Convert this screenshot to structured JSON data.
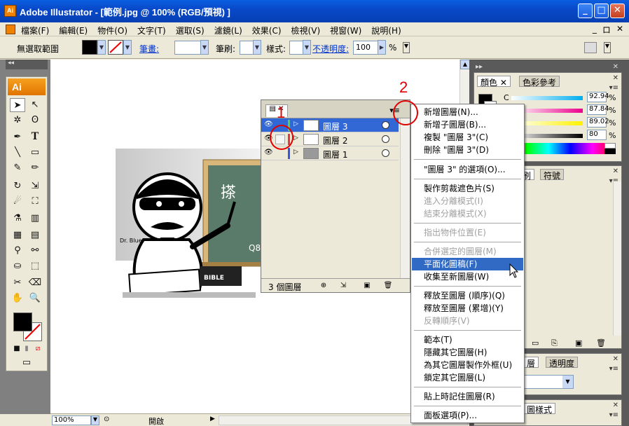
{
  "window": {
    "title": "Adobe Illustrator - [範例.jpg @ 100% (RGB/預視) ]",
    "app_icon": "Ai",
    "minimize": "_",
    "maximize": "□",
    "close": "✕"
  },
  "menubar": {
    "items": [
      "檔案(F)",
      "編輯(E)",
      "物件(O)",
      "文字(T)",
      "選取(S)",
      "濾鏡(L)",
      "效果(C)",
      "檢視(V)",
      "視窗(W)",
      "說明(H)"
    ],
    "mdi": [
      "_",
      "ロ",
      "✕"
    ]
  },
  "controlbar": {
    "selection_label": "無選取範圍",
    "stroke_label": "筆畫:",
    "brush_label": "筆刷:",
    "style_label": "樣式:",
    "opacity_label": "不透明度:",
    "opacity_value": "100",
    "opacity_unit": "%"
  },
  "toolbox": {
    "ai_label": "Ai",
    "strip_label": "◂◂"
  },
  "statusbar": {
    "zoom": "100%",
    "status": "開啟"
  },
  "color_panel": {
    "tabs": [
      "顏色",
      "色彩參考"
    ],
    "channels": [
      {
        "label": "C",
        "value": "92.94",
        "unit": "%",
        "color": "#00aeef"
      },
      {
        "label": "M",
        "value": "87.84",
        "unit": "%",
        "color": "#ec008c"
      },
      {
        "label": "Y",
        "value": "89.02",
        "unit": "%",
        "color": "#fff200"
      },
      {
        "label": "K",
        "value": "80",
        "unit": "%",
        "color": "#000000"
      }
    ]
  },
  "brushes_panel": {
    "tabs": [
      "刷",
      "符號"
    ]
  },
  "transparency_panel": {
    "tabs": [
      "層",
      "透明度"
    ]
  },
  "graphic_styles_panel": {
    "tabs": [
      "圖樣式"
    ]
  },
  "layers_panel": {
    "rows": [
      {
        "name": "圖層 3",
        "color": "#4fd34f",
        "selected": true
      },
      {
        "name": "圖層 2",
        "color": "#e03a3a",
        "selected": false
      },
      {
        "name": "圖層 1",
        "color": "#3a55e0",
        "selected": false
      }
    ],
    "count_label": "3 個圖層"
  },
  "context_menu": {
    "items": [
      {
        "label": "新增圖層(N)...",
        "state": "normal"
      },
      {
        "label": "新增子圖層(B)...",
        "state": "normal"
      },
      {
        "label": "複製 \"圖層 3\"(C)",
        "state": "normal"
      },
      {
        "label": "刪除 \"圖層 3\"(D)",
        "state": "normal"
      },
      {
        "label": "\"圖層 3\" 的選項(O)...",
        "state": "normal"
      },
      {
        "label": "製作剪裁遮色片(S)",
        "state": "normal"
      },
      {
        "label": "進入分離模式(I)",
        "state": "disabled"
      },
      {
        "label": "結束分離模式(X)",
        "state": "disabled"
      },
      {
        "label": "指出物件位置(E)",
        "state": "disabled"
      },
      {
        "label": "合併選定的圖層(M)",
        "state": "disabled"
      },
      {
        "label": "平面化圖稿(F)",
        "state": "highlighted"
      },
      {
        "label": "收集至新圖層(W)",
        "state": "normal"
      },
      {
        "label": "釋放至圖層 (順序)(Q)",
        "state": "normal"
      },
      {
        "label": "釋放至圖層 (累增)(Y)",
        "state": "normal"
      },
      {
        "label": "反轉順序(V)",
        "state": "disabled"
      },
      {
        "label": "範本(T)",
        "state": "normal"
      },
      {
        "label": "隱藏其它圖層(H)",
        "state": "normal"
      },
      {
        "label": "為其它圖層製作外框(U)",
        "state": "normal"
      },
      {
        "label": "鎖定其它圖層(L)",
        "state": "normal"
      },
      {
        "label": "貼上時記住圖層(R)",
        "state": "normal"
      },
      {
        "label": "面板選項(P)...",
        "state": "normal"
      }
    ]
  },
  "annotations": {
    "label_1": "1",
    "label_2": "2",
    "circle_color": "#e00000"
  },
  "illustration": {
    "board_text_1": "搽",
    "board_text_2": "Q8",
    "caption": "Dr. Blue",
    "book_text": "BIBLE"
  }
}
